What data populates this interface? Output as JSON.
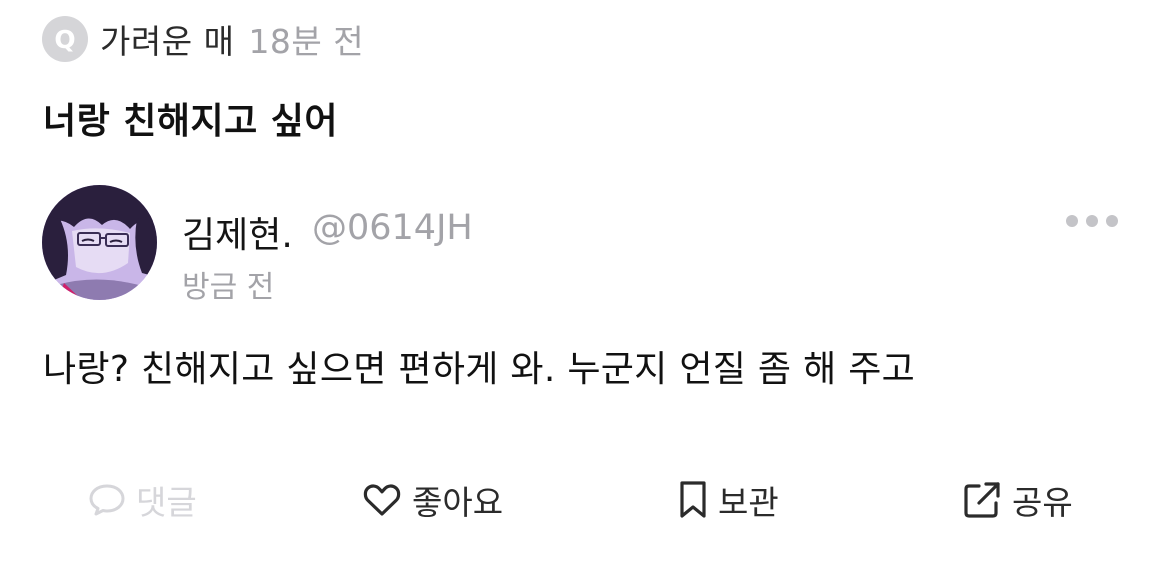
{
  "question": {
    "badge": "Q",
    "asker": "가려운 매",
    "time": "18분 전",
    "text": "너랑 친해지고 싶어"
  },
  "answer": {
    "author_name": "김제현.",
    "author_handle": "@0614JH",
    "time": "방금 전",
    "text": "나랑? 친해지고 싶으면 편하게 와. 누군지 언질 좀 해 주고",
    "more_icon": "more-horizontal-icon"
  },
  "actions": {
    "comment": {
      "label": "댓글",
      "icon": "speech-bubble-icon",
      "enabled": false
    },
    "like": {
      "label": "좋아요",
      "icon": "heart-icon"
    },
    "save": {
      "label": "보관",
      "icon": "bookmark-icon"
    },
    "share": {
      "label": "공유",
      "icon": "share-icon"
    }
  },
  "colors": {
    "muted": "#a3a3a8",
    "disabled": "#d6d6da",
    "text": "#111111",
    "badge": "#d5d5d8"
  }
}
